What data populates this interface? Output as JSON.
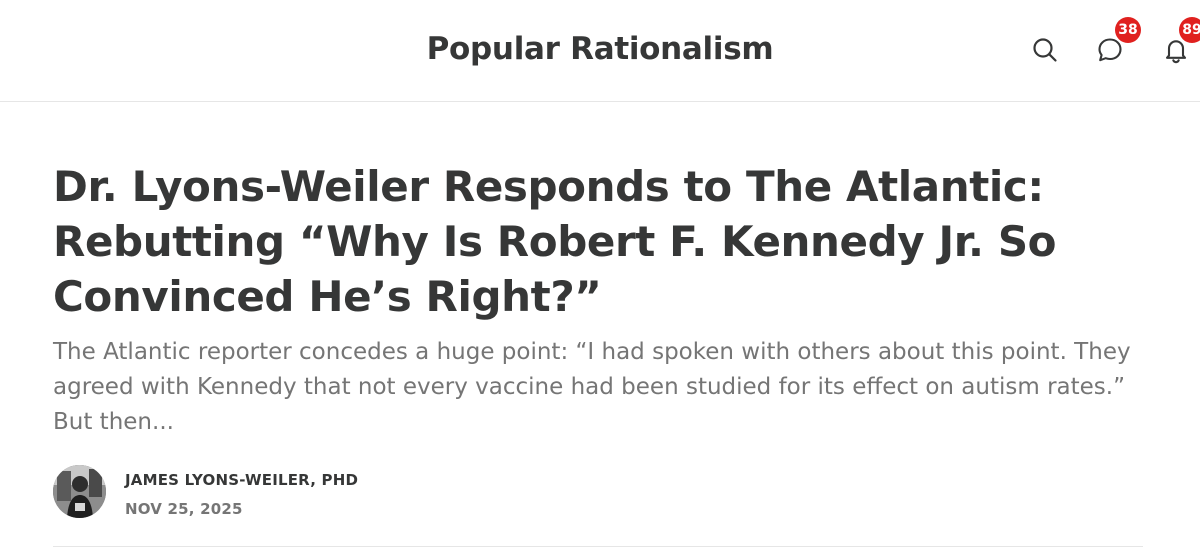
{
  "header": {
    "publication_name": "Popular Rationalism",
    "icons": {
      "search": "search-icon",
      "chat": "chat-bubble-icon",
      "notifications": "bell-icon"
    },
    "chat_badge": "38",
    "notifications_badge": "89",
    "badge_color": "#e0211f"
  },
  "post": {
    "title": "Dr. Lyons-Weiler Responds to The Atlantic: Rebutting “Why Is Robert F. Kennedy Jr. So Convinced He’s Right?”",
    "subtitle": "The Atlantic reporter concedes a huge point: “I had spoken with others about this point. They agreed with Kennedy that not every vaccine had been studied for its effect on autism rates.” But then...",
    "author": "JAMES LYONS-WEILER, PHD",
    "date": "NOV 25, 2025"
  }
}
